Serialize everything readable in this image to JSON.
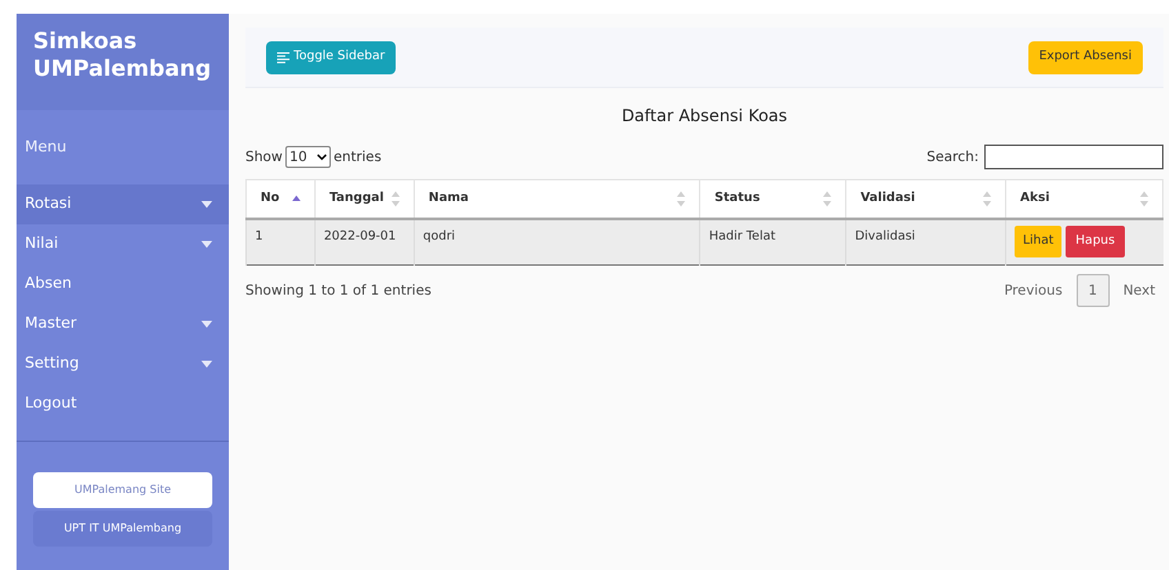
{
  "sidebar": {
    "title": "Simkoas UMPalembang",
    "menu_heading": "Menu",
    "items": [
      {
        "label": "Rotasi",
        "selected": true,
        "has_submenu": true
      },
      {
        "label": "Nilai",
        "selected": false,
        "has_submenu": true
      },
      {
        "label": "Absen",
        "selected": false,
        "has_submenu": false
      },
      {
        "label": "Master",
        "selected": false,
        "has_submenu": true
      },
      {
        "label": "Setting",
        "selected": false,
        "has_submenu": true
      },
      {
        "label": "Logout",
        "selected": false,
        "has_submenu": false
      }
    ],
    "links": [
      {
        "label": "UMPalemang Site",
        "kind": "light"
      },
      {
        "label": "UPT IT UMPalembang",
        "kind": "dark"
      }
    ]
  },
  "navbar": {
    "toggle": "Toggle Sidebar",
    "export": "Export Absensi"
  },
  "table_title": "Daftar Absensi Koas",
  "length": {
    "show": "Show",
    "value": "10",
    "entries": "entries"
  },
  "search": {
    "label": "Search:"
  },
  "table": {
    "columns": [
      {
        "label": "No",
        "sorted_ascending": true
      },
      {
        "label": "Tanggal",
        "sorted_ascending": false
      },
      {
        "label": "Nama",
        "sorted_ascending": false
      },
      {
        "label": "Status",
        "sorted_ascending": false
      },
      {
        "label": "Validasi",
        "sorted_ascending": false
      },
      {
        "label": "Aksi",
        "sorted_ascending": false
      }
    ],
    "rows": [
      {
        "cells": [
          "1",
          "2022-09-01",
          "qodri",
          "Hadir Telat",
          "Divalidasi"
        ],
        "actions": [
          "Lihat",
          "Hapus"
        ]
      }
    ]
  },
  "info": "Showing 1 to 1 of 1 entries",
  "pagination": {
    "previous": "Previous",
    "pages": [
      {
        "label": "1",
        "selected": true
      }
    ],
    "next": "Next"
  }
}
